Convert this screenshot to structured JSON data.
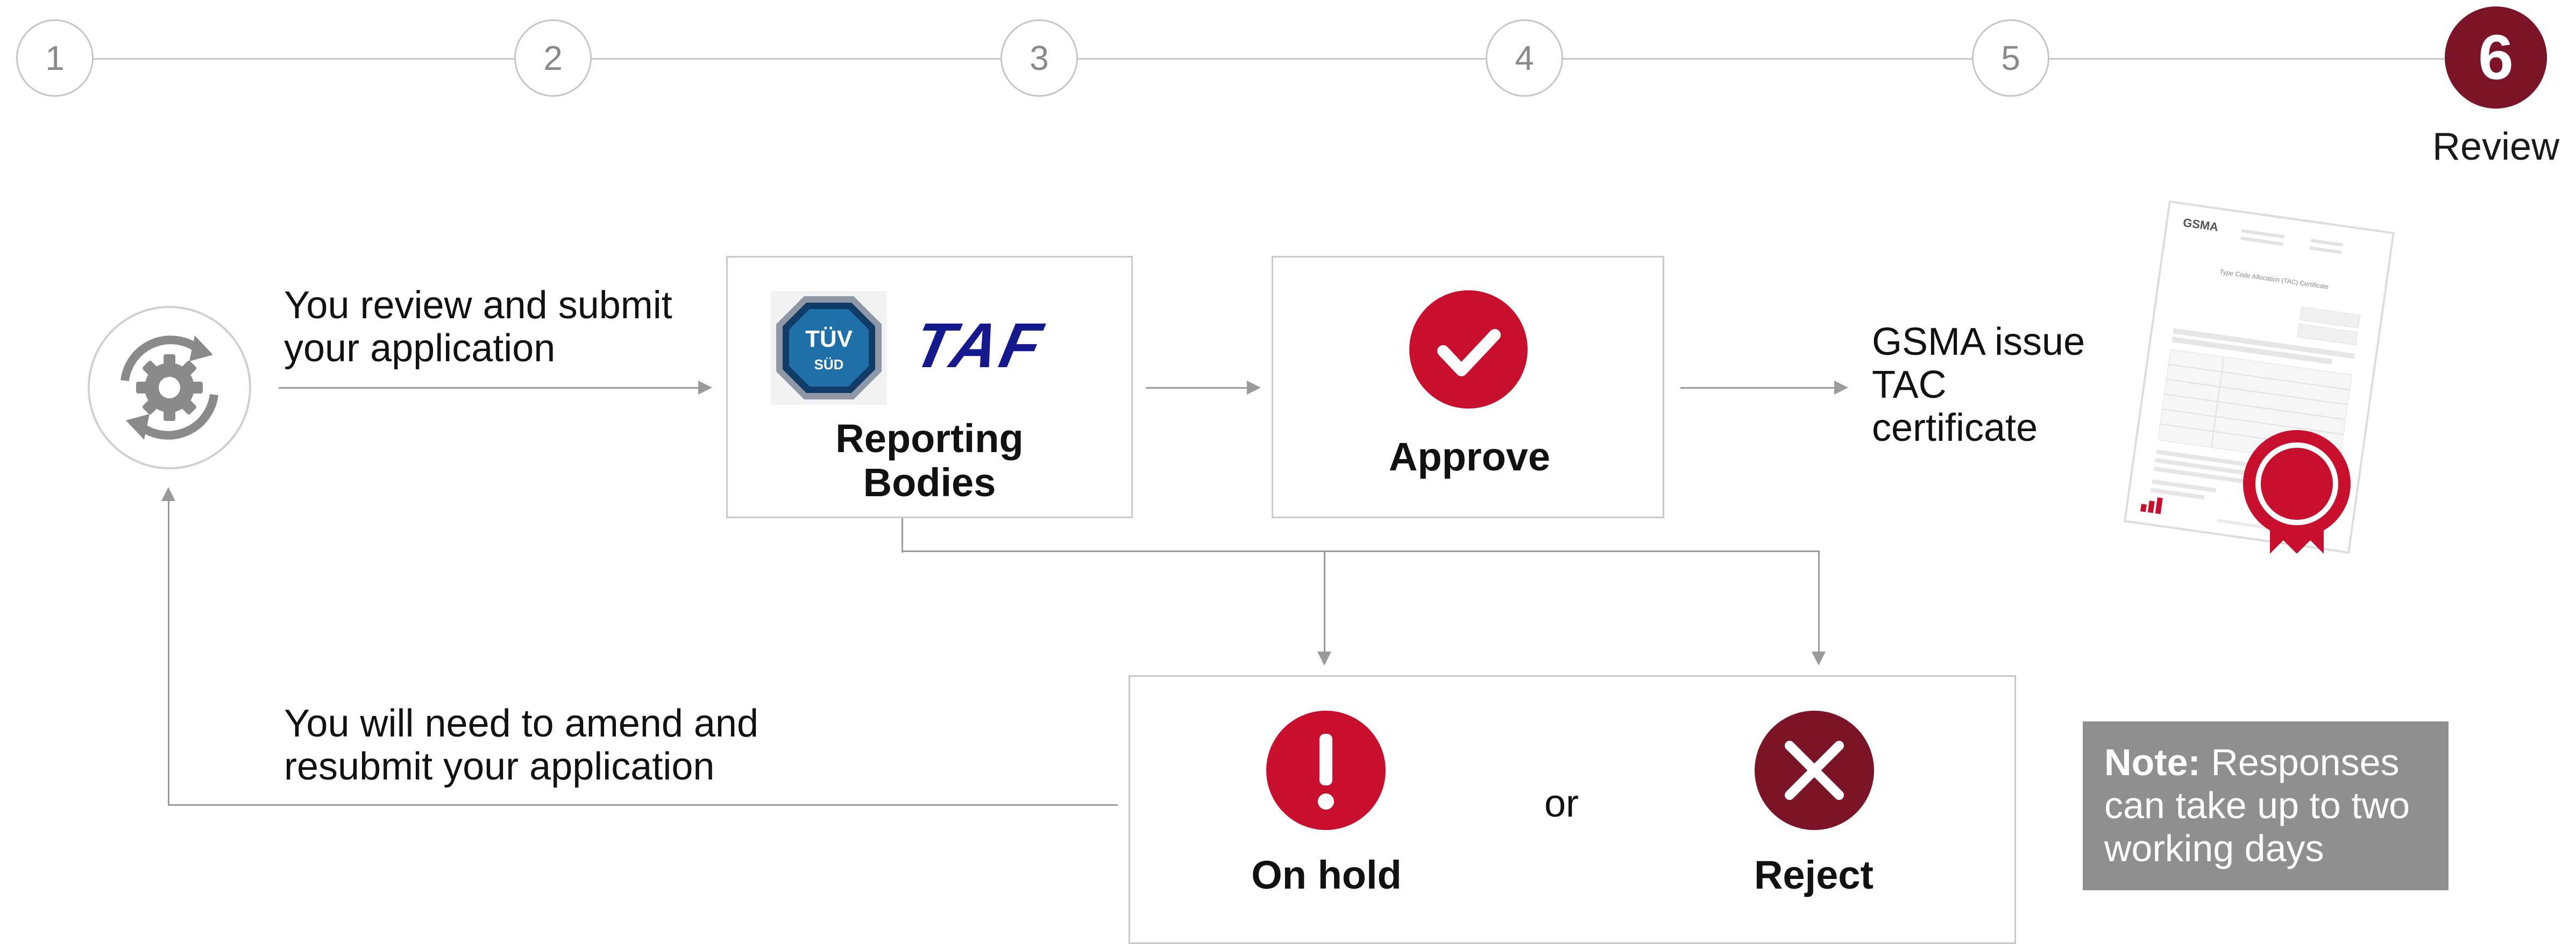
{
  "stepper": {
    "steps": [
      "1",
      "2",
      "3",
      "4",
      "5",
      "6"
    ],
    "active_label": "Review"
  },
  "flow": {
    "submit_text": "You review and submit your application",
    "reporting_label": "Reporting Bodies",
    "logos": {
      "tuv_top": "TÜV",
      "tuv_bottom": "SÜD",
      "taf": "TAF"
    },
    "approve_label": "Approve",
    "issue_text": "GSMA issue TAC certificate",
    "amend_text": "You will need to amend and resubmit your application",
    "on_hold_label": "On hold",
    "or_text": "or",
    "reject_label": "Reject"
  },
  "certificate": {
    "brand": "GSMA",
    "title": "Type Code Allocation (TAC) Certificate"
  },
  "note": {
    "prefix": "Note:",
    "text": "Responses can take up to two working days"
  },
  "colors": {
    "accent_red": "#c8102e",
    "dark_red": "#7a1426",
    "note_gray": "#8f8f8f",
    "line_gray": "#9a9a9a"
  }
}
